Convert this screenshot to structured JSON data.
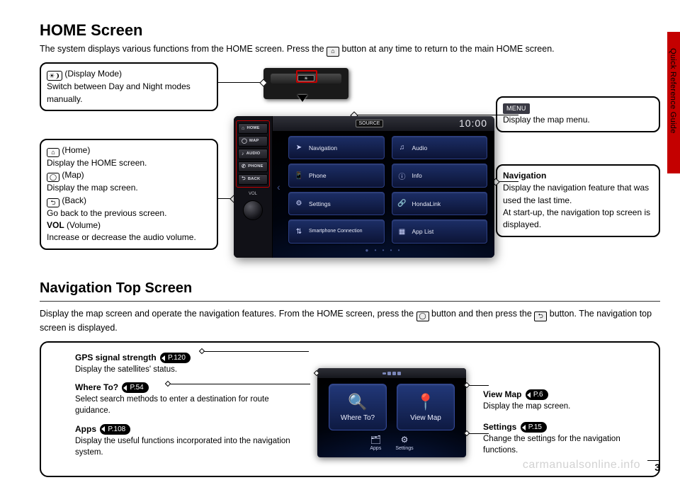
{
  "side_tab_label": "Quick Reference Guide",
  "page_number": "3",
  "watermark": "carmanualsonline.info",
  "section1": {
    "title": "HOME Screen",
    "intro_pre": "The system displays various functions from the HOME screen. Press the ",
    "intro_post": " button at any time to return to the main HOME screen."
  },
  "callouts": {
    "display_mode": {
      "label": "(Display Mode)",
      "text": "Switch between Day and Night modes manually."
    },
    "menu": {
      "chip": "MENU",
      "text": "Display the map menu."
    },
    "navigation": {
      "title": "Navigation",
      "line1": "Display the navigation feature that was used the last time.",
      "line2": "At start-up, the navigation top screen is displayed."
    },
    "left": {
      "home_label": "(Home)",
      "home_text": "Display the HOME screen.",
      "map_label": "(Map)",
      "map_text": "Display the map screen.",
      "back_label": "(Back)",
      "back_text": "Go back to the previous screen.",
      "vol_bold": "VOL",
      "vol_label": " (Volume)",
      "vol_text": "Increase or decrease the audio volume."
    }
  },
  "unit": {
    "phys": {
      "home": "HOME",
      "map": "MAP",
      "audio": "AUDIO",
      "phone": "PHONE",
      "back": "BACK",
      "vol": "VOL"
    },
    "source": "SOURCE",
    "clock": "10:00",
    "tiles": [
      {
        "label": "Navigation",
        "icon": "➤"
      },
      {
        "label": "Audio",
        "icon": "♫"
      },
      {
        "label": "Phone",
        "icon": "📱"
      },
      {
        "label": "Info",
        "icon": "ⓘ"
      },
      {
        "label": "Settings",
        "icon": "⚙"
      },
      {
        "label": "HondaLink",
        "icon": "🔗"
      },
      {
        "label": "Smartphone Connection",
        "icon": "⇅"
      },
      {
        "label": "App List",
        "icon": "▦"
      }
    ]
  },
  "section2": {
    "title": "Navigation Top Screen",
    "intro_pre": "Display the map screen and operate the navigation features. From the HOME screen, press the ",
    "intro_mid": " button and then press the ",
    "intro_post": " button. The navigation top screen is displayed."
  },
  "nav_items": {
    "gps": {
      "title": "GPS signal strength",
      "pref": "P.120",
      "desc": "Display the satellites' status."
    },
    "where": {
      "title": "Where To?",
      "pref": "P.54",
      "desc": "Select search methods to enter a destination for route guidance."
    },
    "apps": {
      "title": "Apps",
      "pref": "P.108",
      "desc": "Display the useful functions incorporated into the navigation system."
    },
    "view": {
      "title": "View Map",
      "pref": "P.6",
      "desc": "Display the map screen."
    },
    "settings": {
      "title": "Settings",
      "pref": "P.15",
      "desc": "Change the settings for the navigation functions."
    }
  },
  "nav_device": {
    "where": "Where To?",
    "view": "View Map",
    "apps": "Apps",
    "settings": "Settings"
  }
}
